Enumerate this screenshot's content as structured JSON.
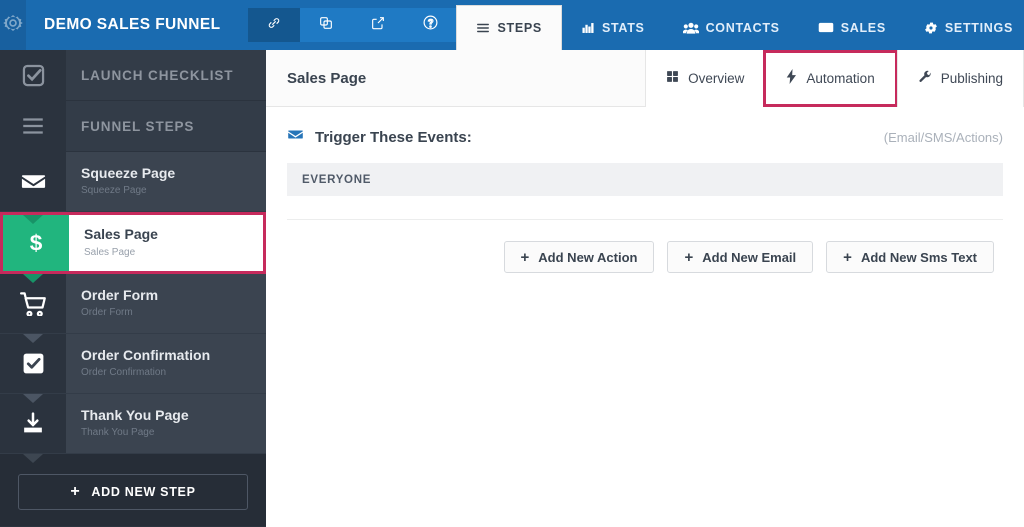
{
  "topbar": {
    "logo_icon": "gear-icon",
    "brand": "DEMO SALES FUNNEL",
    "quick_actions": [
      {
        "icon": "link-icon",
        "name": "share-link-button"
      },
      {
        "icon": "clone-icon",
        "name": "clone-funnel-button"
      },
      {
        "icon": "external-link-icon",
        "name": "open-funnel-button"
      },
      {
        "icon": "help-circle-icon",
        "name": "help-button"
      }
    ],
    "tabs": [
      {
        "label": "STEPS",
        "icon": "list-icon",
        "active": true
      },
      {
        "label": "STATS",
        "icon": "bar-chart-icon",
        "active": false
      },
      {
        "label": "CONTACTS",
        "icon": "users-icon",
        "active": false
      },
      {
        "label": "SALES",
        "icon": "money-icon",
        "active": false
      },
      {
        "label": "SETTINGS",
        "icon": "gear-icon",
        "active": false
      }
    ]
  },
  "sidebar": {
    "headers": [
      {
        "label": "LAUNCH CHECKLIST",
        "icon": "checkbox-outline-icon"
      },
      {
        "label": "FUNNEL STEPS",
        "icon": "hamburger-lines-icon"
      }
    ],
    "steps": [
      {
        "title": "Squeeze Page",
        "subtitle": "Squeeze Page",
        "icon": "envelope-icon",
        "selected": false
      },
      {
        "title": "Sales Page",
        "subtitle": "Sales Page",
        "icon": "dollar-icon",
        "selected": true
      },
      {
        "title": "Order Form",
        "subtitle": "Order Form",
        "icon": "cart-icon",
        "selected": false
      },
      {
        "title": "Order Confirmation",
        "subtitle": "Order Confirmation",
        "icon": "checkbox-filled-icon",
        "selected": false
      },
      {
        "title": "Thank You Page",
        "subtitle": "Thank You Page",
        "icon": "download-icon",
        "selected": false
      }
    ],
    "add_step_label": "ADD NEW STEP",
    "add_step_plus": "+"
  },
  "main": {
    "page_title": "Sales Page",
    "subtabs": [
      {
        "label": "Overview",
        "icon": "grid-icon",
        "highlight": false
      },
      {
        "label": "Automation",
        "icon": "bolt-icon",
        "highlight": true
      },
      {
        "label": "Publishing",
        "icon": "wrench-icon",
        "highlight": false
      }
    ],
    "trigger": {
      "icon": "envelope-icon",
      "title": "Trigger These Events:",
      "note": "(Email/SMS/Actions)"
    },
    "audience_label": "EVERYONE",
    "buttons": [
      {
        "label": "Add New Action",
        "plus": "+",
        "name": "add-new-action-button"
      },
      {
        "label": "Add New Email",
        "plus": "+",
        "name": "add-new-email-button"
      },
      {
        "label": "Add New Sms Text",
        "plus": "+",
        "name": "add-new-sms-text-button"
      }
    ]
  },
  "colors": {
    "brand_blue": "#1a6bb0",
    "sidebar_dark": "#2b333e",
    "sidebar_item": "#3b4450",
    "accent_pink": "#c62a5c",
    "accent_green": "#21b57e"
  }
}
